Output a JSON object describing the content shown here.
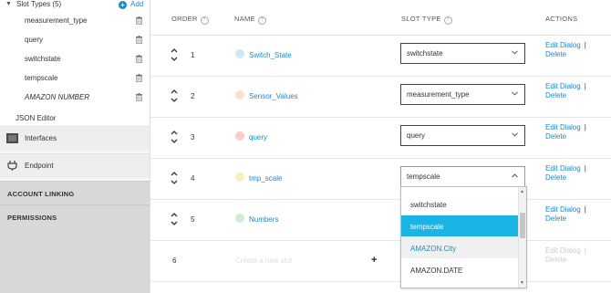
{
  "sidebar": {
    "slot_types_label": "Slot Types (5)",
    "add_label": "Add",
    "slot_types": [
      {
        "name": "measurement_type",
        "italic": false
      },
      {
        "name": "query",
        "italic": false
      },
      {
        "name": "switchstate",
        "italic": false
      },
      {
        "name": "tempscale",
        "italic": false
      },
      {
        "name": "AMAZON NUMBER",
        "italic": true
      }
    ],
    "json_editor_label": "JSON Editor",
    "nav": [
      {
        "label": "Interfaces",
        "icon": "interfaces-icon"
      },
      {
        "label": "Endpoint",
        "icon": "plug-icon"
      }
    ],
    "sections": [
      "ACCOUNT LINKING",
      "PERMISSIONS"
    ]
  },
  "table": {
    "headers": {
      "order": "ORDER",
      "name": "NAME",
      "slot_type": "SLOT TYPE",
      "actions": "ACTIONS"
    },
    "help_glyph": "?",
    "rows": [
      {
        "order": "1",
        "name": "Switch_State",
        "slot_type": "switchstate",
        "dot_color": "#cfe8f8"
      },
      {
        "order": "2",
        "name": "Sensor_Values",
        "slot_type": "measurement_type",
        "dot_color": "#fbe0cc"
      },
      {
        "order": "3",
        "name": "query",
        "slot_type": "query",
        "dot_color": "#f9cccc"
      },
      {
        "order": "4",
        "name": "tmp_scale",
        "slot_type": "tempscale",
        "dot_color": "#f6f1b8"
      },
      {
        "order": "5",
        "name": "Numbers",
        "slot_type": "",
        "dot_color": "#cfeecf"
      }
    ],
    "actions": {
      "edit": "Edit Dialog",
      "sep": "|",
      "delete": "Delete"
    },
    "new_row": {
      "order": "6",
      "placeholder": "Create a new slot",
      "plus": "+"
    }
  },
  "dropdown": {
    "options": [
      {
        "label": "switchstate",
        "state": "normal"
      },
      {
        "label": "tempscale",
        "state": "selected"
      },
      {
        "label": "AMAZON.City",
        "state": "link"
      },
      {
        "label": "AMAZON.DATE",
        "state": "normal"
      }
    ]
  },
  "colors": {
    "accent": "#1a8bc9",
    "selected": "#1ab3e6"
  }
}
